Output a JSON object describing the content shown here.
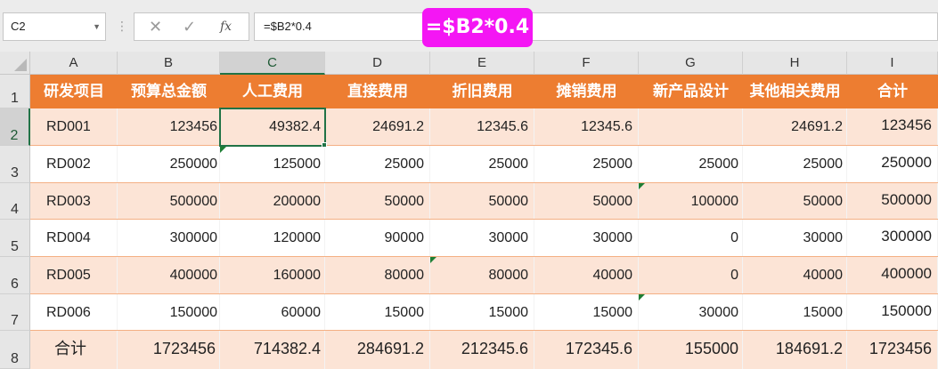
{
  "formula_bar": {
    "cell_ref": "C2",
    "caret_icon": "dropdown-caret-icon",
    "dots_icon": "vertical-dots-icon",
    "cancel_icon": "x-icon",
    "enter_icon": "check-icon",
    "fx_icon": "function-icon",
    "cancel_glyph": "✕",
    "enter_glyph": "✓",
    "fx_glyph": "fx",
    "formula": "=$B2*0.4"
  },
  "callout": {
    "text": "=$B2*0.4",
    "color": "#f416f4"
  },
  "columns": [
    "A",
    "B",
    "C",
    "D",
    "E",
    "F",
    "G",
    "H",
    "I"
  ],
  "rows": [
    "1",
    "2",
    "3",
    "4",
    "5",
    "6",
    "7",
    "8"
  ],
  "header": [
    "研发项目",
    "预算总金额",
    "人工费用",
    "直接费用",
    "折旧费用",
    "摊销费用",
    "新产品设计",
    "其他相关费用",
    "合计"
  ],
  "records": [
    [
      "RD001",
      "123456",
      "49382.4",
      "24691.2",
      "12345.6",
      "12345.6",
      "",
      "24691.2",
      "123456"
    ],
    [
      "RD002",
      "250000",
      "125000",
      "25000",
      "25000",
      "25000",
      "25000",
      "25000",
      "250000"
    ],
    [
      "RD003",
      "500000",
      "200000",
      "50000",
      "50000",
      "50000",
      "100000",
      "50000",
      "500000"
    ],
    [
      "RD004",
      "300000",
      "120000",
      "90000",
      "30000",
      "30000",
      "0",
      "30000",
      "300000"
    ],
    [
      "RD005",
      "400000",
      "160000",
      "80000",
      "80000",
      "40000",
      "0",
      "40000",
      "400000"
    ],
    [
      "RD006",
      "150000",
      "60000",
      "15000",
      "15000",
      "15000",
      "30000",
      "15000",
      "150000"
    ]
  ],
  "total": [
    "合计",
    "1723456",
    "714382.4",
    "284691.2",
    "212345.6",
    "172345.6",
    "155000",
    "184691.2",
    "1723456"
  ],
  "colors": {
    "header_fill": "#ed7d31",
    "band_fill": "#fce4d6",
    "selection": "#217346"
  }
}
